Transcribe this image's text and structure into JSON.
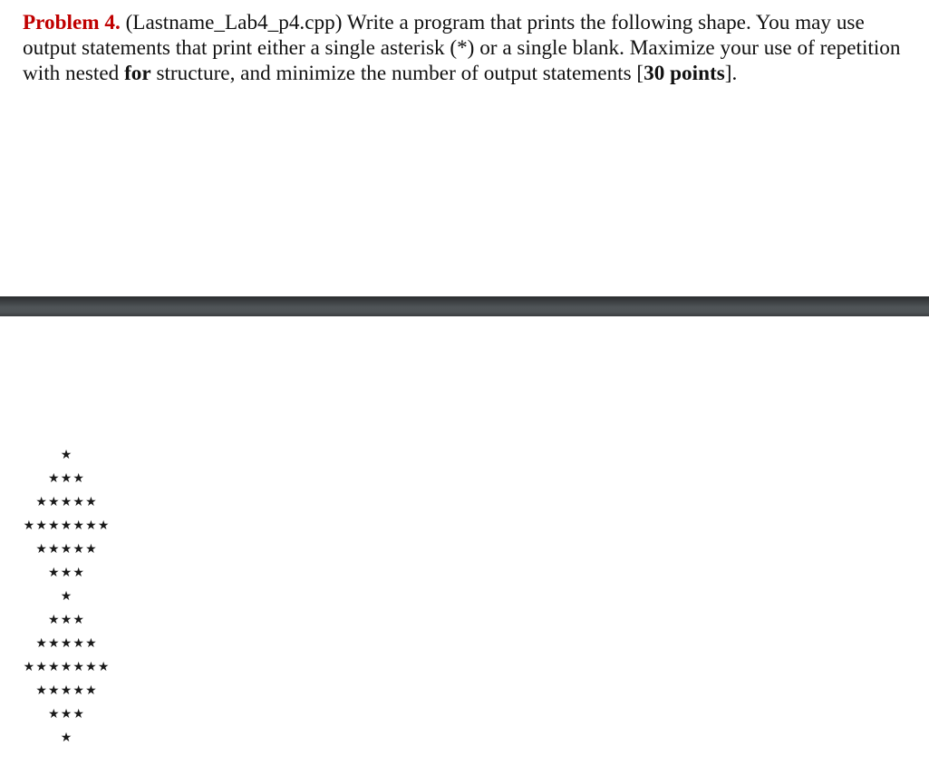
{
  "problem": {
    "label": "Problem 4.",
    "filename": " (Lastname_Lab4_p4.cpp) Write a program that prints the following shape. You may use output statements that print either a single asterisk (*) or a single blank. Maximize your use of repetition with nested ",
    "keyword": "for",
    "middle": " structure, and minimize the number of output statements [",
    "points": "30 points",
    "end": "]."
  },
  "colors": {
    "problem_label": "#c00000",
    "divider": "#4e5356"
  },
  "shape": {
    "glyph": "★",
    "rows": [
      1,
      3,
      5,
      7,
      5,
      3,
      1,
      3,
      5,
      7,
      5,
      3,
      1
    ]
  }
}
